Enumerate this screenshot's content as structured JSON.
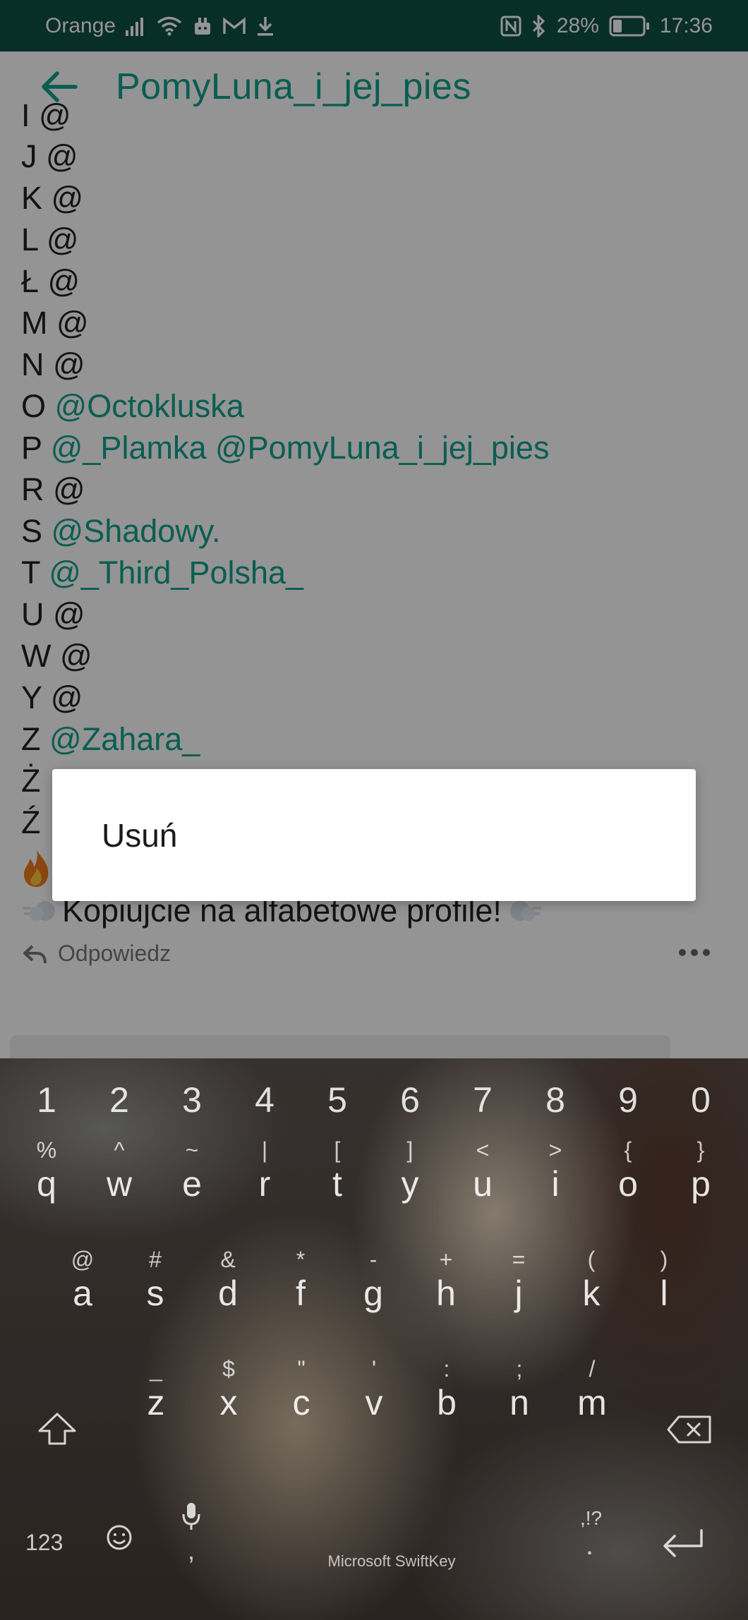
{
  "status_bar": {
    "carrier": "Orange",
    "battery": "28%",
    "time": "17:36"
  },
  "app_bar": {
    "title": "PomyLuna_i_jej_pies"
  },
  "post": {
    "partial_top": "I @",
    "lines": [
      {
        "letter": "J",
        "text": "@",
        "mentions": ""
      },
      {
        "letter": "K",
        "text": "@",
        "mentions": ""
      },
      {
        "letter": "L",
        "text": "@",
        "mentions": ""
      },
      {
        "letter": "Ł",
        "text": "@",
        "mentions": ""
      },
      {
        "letter": "M",
        "text": "@",
        "mentions": ""
      },
      {
        "letter": "N",
        "text": "@",
        "mentions": ""
      },
      {
        "letter": "O",
        "text": "",
        "mentions": "@Octokluska"
      },
      {
        "letter": "P",
        "text": "",
        "mentions": "@_Plamka @PomyLuna_i_jej_pies"
      },
      {
        "letter": "R",
        "text": "@",
        "mentions": ""
      },
      {
        "letter": "S",
        "text": "",
        "mentions": "@Shadowy."
      },
      {
        "letter": "T",
        "text": "",
        "mentions": "@_Third_Polsha_"
      },
      {
        "letter": "U",
        "text": "@",
        "mentions": ""
      },
      {
        "letter": "W",
        "text": "@",
        "mentions": ""
      },
      {
        "letter": "Y",
        "text": "@",
        "mentions": ""
      },
      {
        "letter": "Z",
        "text": "",
        "mentions": "@Zahara_"
      },
      {
        "letter": "Ż",
        "text": "",
        "mentions": ""
      },
      {
        "letter": "Ź",
        "text": "",
        "mentions": ""
      }
    ],
    "closing_text": "Kopiujcie na alfabetowe profile!",
    "reply_label": "Odpowiedz"
  },
  "dialog": {
    "item": "Usuń"
  },
  "keyboard": {
    "numbers": [
      "1",
      "2",
      "3",
      "4",
      "5",
      "6",
      "7",
      "8",
      "9",
      "0"
    ],
    "row1": [
      {
        "alt": "%",
        "main": "q"
      },
      {
        "alt": "^",
        "main": "w"
      },
      {
        "alt": "~",
        "main": "e"
      },
      {
        "alt": "|",
        "main": "r"
      },
      {
        "alt": "[",
        "main": "t"
      },
      {
        "alt": "]",
        "main": "y"
      },
      {
        "alt": "<",
        "main": "u"
      },
      {
        "alt": ">",
        "main": "i"
      },
      {
        "alt": "{",
        "main": "o"
      },
      {
        "alt": "}",
        "main": "p"
      }
    ],
    "row2": [
      {
        "alt": "@",
        "main": "a"
      },
      {
        "alt": "#",
        "main": "s"
      },
      {
        "alt": "&",
        "main": "d"
      },
      {
        "alt": "*",
        "main": "f"
      },
      {
        "alt": "-",
        "main": "g"
      },
      {
        "alt": "+",
        "main": "h"
      },
      {
        "alt": "=",
        "main": "j"
      },
      {
        "alt": "(",
        "main": "k"
      },
      {
        "alt": ")",
        "main": "l"
      }
    ],
    "row3": [
      {
        "alt": "_",
        "main": "z"
      },
      {
        "alt": "$",
        "main": "x"
      },
      {
        "alt": "\"",
        "main": "c"
      },
      {
        "alt": "'",
        "main": "v"
      },
      {
        "alt": ":",
        "main": "b"
      },
      {
        "alt": ";",
        "main": "n"
      },
      {
        "alt": "/",
        "main": "m"
      }
    ],
    "symbols_key": "123",
    "comma_key": ",",
    "period_key": ".",
    "punct_alt": ",!?",
    "brand": "Microsoft SwiftKey"
  },
  "colors": {
    "status_bar": "#0e5045",
    "accent": "#10a08e"
  }
}
